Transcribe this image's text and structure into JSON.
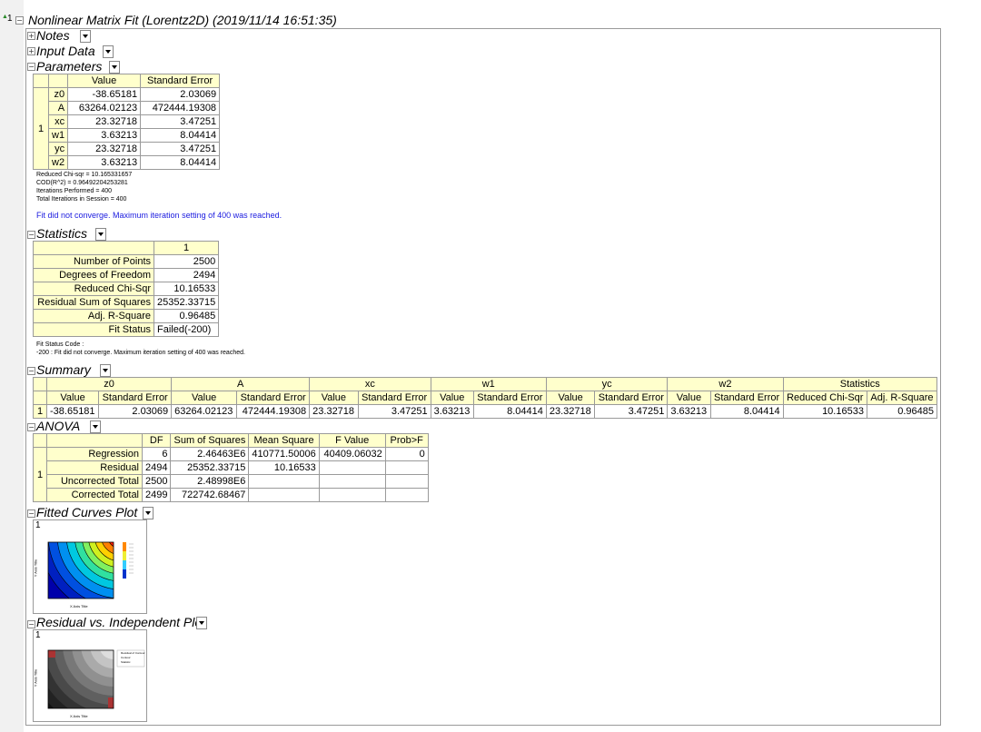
{
  "report": {
    "node_index": "1",
    "title": "Nonlinear Matrix Fit (Lorentz2D) (2019/11/14 16:51:35)"
  },
  "sections": {
    "notes": "Notes",
    "input_data": "Input Data",
    "parameters": "Parameters",
    "statistics": "Statistics",
    "summary": "Summary",
    "anova": "ANOVA",
    "fitted_curves": "Fitted Curves Plot",
    "residual": "Residual vs. Independent Plot"
  },
  "parameters": {
    "col_value": "Value",
    "col_se": "Standard Error",
    "group": "1",
    "rows": [
      {
        "name": "z0",
        "value": "-38.65181",
        "se": "2.03069"
      },
      {
        "name": "A",
        "value": "63264.02123",
        "se": "472444.19308"
      },
      {
        "name": "xc",
        "value": "23.32718",
        "se": "3.47251"
      },
      {
        "name": "w1",
        "value": "3.63213",
        "se": "8.04414"
      },
      {
        "name": "yc",
        "value": "23.32718",
        "se": "3.47251"
      },
      {
        "name": "w2",
        "value": "3.63213",
        "se": "8.04414"
      }
    ],
    "notes": [
      "Reduced Chi-sqr = 10.165331657",
      "COD(R^2) = 0.96492204253281",
      "Iterations Performed = 400",
      "Total Iterations in Session = 400"
    ],
    "warning": "Fit did not converge. Maximum iteration setting of 400 was reached."
  },
  "statistics": {
    "col": "1",
    "rows": [
      {
        "name": "Number of Points",
        "value": "2500"
      },
      {
        "name": "Degrees of Freedom",
        "value": "2494"
      },
      {
        "name": "Reduced Chi-Sqr",
        "value": "10.16533"
      },
      {
        "name": "Residual Sum of Squares",
        "value": "25352.33715"
      },
      {
        "name": "Adj. R-Square",
        "value": "0.96485"
      },
      {
        "name": "Fit Status",
        "value": "Failed(-200)"
      }
    ],
    "code_label": "Fit Status Code :",
    "code_line": "-200 : Fit did not converge. Maximum iteration setting of 400 was reached."
  },
  "summary": {
    "groups": [
      "z0",
      "A",
      "xc",
      "w1",
      "yc",
      "w2",
      "Statistics"
    ],
    "sub": [
      "Value",
      "Standard Error",
      "Value",
      "Standard Error",
      "Value",
      "Standard Error",
      "Value",
      "Standard Error",
      "Value",
      "Standard Error",
      "Value",
      "Standard Error",
      "Reduced Chi-Sqr",
      "Adj. R-Square"
    ],
    "row_label": "1",
    "values": [
      "-38.65181",
      "2.03069",
      "63264.02123",
      "472444.19308",
      "23.32718",
      "3.47251",
      "3.63213",
      "8.04414",
      "23.32718",
      "3.47251",
      "3.63213",
      "8.04414",
      "10.16533",
      "0.96485"
    ]
  },
  "anova": {
    "cols": [
      "DF",
      "Sum of Squares",
      "Mean Square",
      "F Value",
      "Prob>F"
    ],
    "group": "1",
    "rows": [
      {
        "name": "Regression",
        "df": "6",
        "ss": "2.46463E6",
        "ms": "410771.50006",
        "f": "40409.06032",
        "p": "0"
      },
      {
        "name": "Residual",
        "df": "2494",
        "ss": "25352.33715",
        "ms": "10.16533",
        "f": "",
        "p": ""
      },
      {
        "name": "Uncorrected Total",
        "df": "2500",
        "ss": "2.48998E6",
        "ms": "",
        "f": "",
        "p": ""
      },
      {
        "name": "Corrected Total",
        "df": "2499",
        "ss": "722742.68467",
        "ms": "",
        "f": "",
        "p": ""
      }
    ]
  },
  "plots": {
    "fitted_index": "1",
    "residual_index": "1",
    "fitted_xlabel": "X Axis Title",
    "fitted_ylabel": "Y Axis Title",
    "residual_xlabel": "X Axis Title",
    "residual_ylabel": "Y Axis Title",
    "residual_legend": [
      "Residual of Contour",
      "Contour",
      "Statistic"
    ]
  }
}
